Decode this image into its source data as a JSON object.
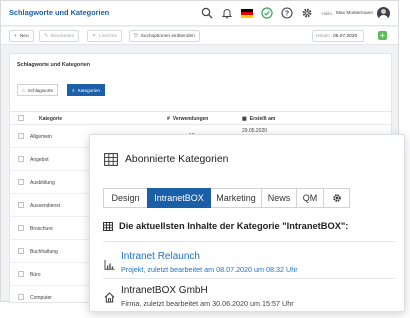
{
  "header": {
    "title": "Schlagworte und Kategorien",
    "greeting": "Hallo",
    "user": "Max Mustermann",
    "colors": {
      "accent": "#1a5fa7",
      "success": "#3aa35a",
      "add": "#5fb85a"
    }
  },
  "toolbar": {
    "new_label": "Neu",
    "edit_label": "Bearbeiten",
    "delete_label": "Löschen",
    "search_options_label": "Suchoptionen einblenden",
    "date_label": "Heute:",
    "date_value": "06.07.2020",
    "add_label": "+"
  },
  "card": {
    "title": "Schlagworte und Kategorien",
    "tabs": [
      {
        "label": "Schlagworte",
        "icon": "tag-icon"
      },
      {
        "label": "Kategorien",
        "icon": "list-icon"
      }
    ],
    "columns": {
      "category": "Kategorie",
      "hash": "#",
      "uses": "Verwendungen",
      "created": "Erstellt am"
    },
    "rows": [
      {
        "name": "Allgemein",
        "uses": "18",
        "created": "29.05.2020"
      },
      {
        "name": "Angebot",
        "uses": "",
        "created": ""
      },
      {
        "name": "Ausbildung",
        "uses": "",
        "created": ""
      },
      {
        "name": "Aussendienst",
        "uses": "",
        "created": ""
      },
      {
        "name": "Broschure",
        "uses": "",
        "created": ""
      },
      {
        "name": "Buchhaltung",
        "uses": "",
        "created": ""
      },
      {
        "name": "Büro",
        "uses": "",
        "created": ""
      },
      {
        "name": "Computer",
        "uses": "",
        "created": ""
      }
    ]
  },
  "popup": {
    "title": "Abonnierte Kategorien",
    "tabs": [
      "Design",
      "IntranetBOX",
      "Marketing",
      "News",
      "QM"
    ],
    "settings_icon": "gear-icon",
    "latest_heading": "Die aktuellsten Inhalte der Kategorie \"IntranetBOX\":",
    "items": [
      {
        "title": "Intranet Relaunch",
        "meta": "Projekt, zuletzt bearbeitet am 08.07.2020 um 08:32 Uhr",
        "icon": "chart-icon",
        "color": "#1a72c9"
      },
      {
        "title": "IntranetBOX GmbH",
        "meta": "Firma, zuletzt bearbeitet am 30.06.2020 um 15:57 Uhr",
        "icon": "home-icon",
        "color": "#222222"
      }
    ]
  }
}
